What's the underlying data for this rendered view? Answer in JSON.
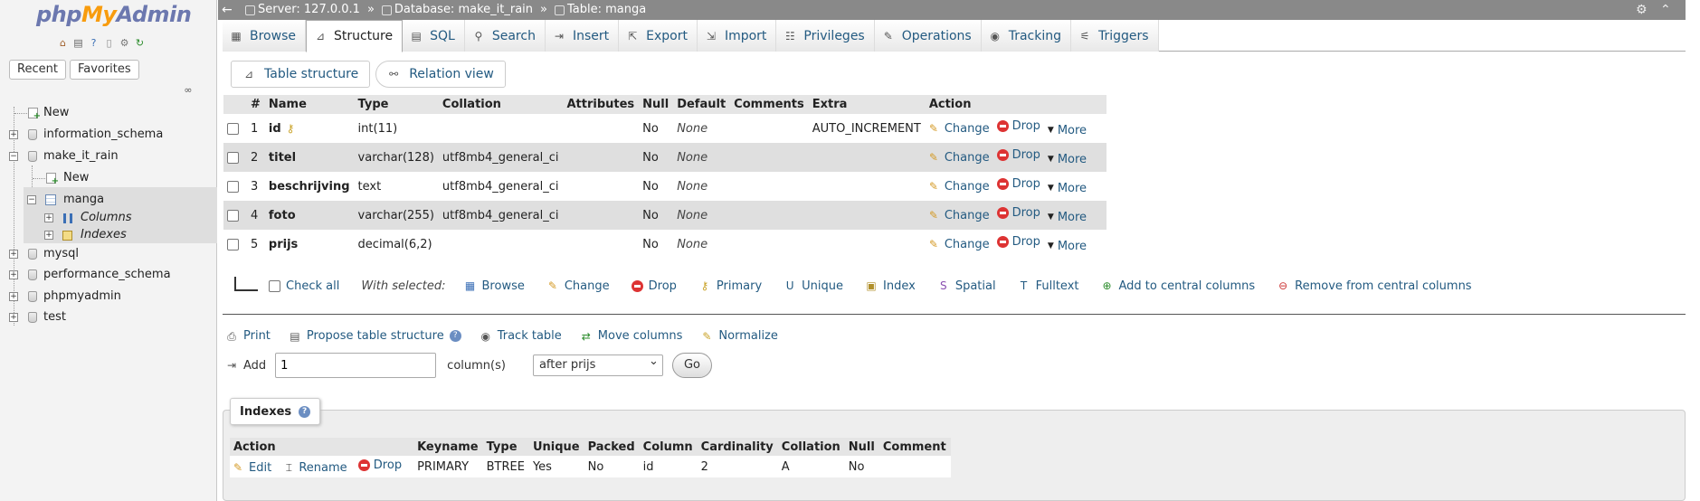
{
  "nav": {
    "logo": {
      "php": "php",
      "my": "My",
      "admin": "Admin"
    },
    "quick_icons": [
      "home-icon",
      "exit-icon",
      "help-icon",
      "docs-icon",
      "settings-icon",
      "reload-icon"
    ],
    "tabs": [
      "Recent",
      "Favorites"
    ],
    "tree": {
      "new": "New",
      "databases": [
        "information_schema",
        "make_it_rain",
        "mysql",
        "performance_schema",
        "phpmyadmin",
        "test"
      ],
      "make_it_rain_children": {
        "new": "New",
        "table": "manga",
        "columns": "Columns",
        "indexes": "Indexes"
      }
    }
  },
  "breadcrumb": {
    "server": "Server: 127.0.0.1",
    "database": "Database: make_it_rain",
    "table": "Table: manga",
    "separator": "»"
  },
  "tabs": [
    {
      "label": "Browse",
      "icon": "browse-icon"
    },
    {
      "label": "Structure",
      "icon": "structure-icon",
      "active": true
    },
    {
      "label": "SQL",
      "icon": "sql-icon"
    },
    {
      "label": "Search",
      "icon": "search-icon"
    },
    {
      "label": "Insert",
      "icon": "insert-icon"
    },
    {
      "label": "Export",
      "icon": "export-icon"
    },
    {
      "label": "Import",
      "icon": "import-icon"
    },
    {
      "label": "Privileges",
      "icon": "privileges-icon"
    },
    {
      "label": "Operations",
      "icon": "operations-icon"
    },
    {
      "label": "Tracking",
      "icon": "tracking-icon"
    },
    {
      "label": "Triggers",
      "icon": "triggers-icon"
    }
  ],
  "subtabs": {
    "table_structure": "Table structure",
    "relation_view": "Relation view"
  },
  "structure": {
    "headers": [
      "#",
      "Name",
      "Type",
      "Collation",
      "Attributes",
      "Null",
      "Default",
      "Comments",
      "Extra",
      "Action"
    ],
    "rows": [
      {
        "num": "1",
        "name": "id",
        "type": "int(11)",
        "collation": "",
        "attributes": "",
        "null": "No",
        "default": "None",
        "comments": "",
        "extra": "AUTO_INCREMENT"
      },
      {
        "num": "2",
        "name": "titel",
        "type": "varchar(128)",
        "collation": "utf8mb4_general_ci",
        "attributes": "",
        "null": "No",
        "default": "None",
        "comments": "",
        "extra": ""
      },
      {
        "num": "3",
        "name": "beschrijving",
        "type": "text",
        "collation": "utf8mb4_general_ci",
        "attributes": "",
        "null": "No",
        "default": "None",
        "comments": "",
        "extra": ""
      },
      {
        "num": "4",
        "name": "foto",
        "type": "varchar(255)",
        "collation": "utf8mb4_general_ci",
        "attributes": "",
        "null": "No",
        "default": "None",
        "comments": "",
        "extra": ""
      },
      {
        "num": "5",
        "name": "prijs",
        "type": "decimal(6,2)",
        "collation": "",
        "attributes": "",
        "null": "No",
        "default": "None",
        "comments": "",
        "extra": ""
      }
    ],
    "actions": {
      "change": "Change",
      "drop": "Drop",
      "more": "More"
    }
  },
  "bulk": {
    "check_all": "Check all",
    "with_selected": "With selected:",
    "items": [
      "Browse",
      "Change",
      "Drop",
      "Primary",
      "Unique",
      "Index",
      "Spatial",
      "Fulltext",
      "Add to central columns",
      "Remove from central columns"
    ]
  },
  "tools": {
    "print": "Print",
    "propose": "Propose table structure",
    "track": "Track table",
    "move": "Move columns",
    "normalize": "Normalize"
  },
  "add_columns": {
    "label": "Add",
    "value": "1",
    "suffix": "column(s)",
    "position": "after prijs",
    "go": "Go"
  },
  "indexes": {
    "legend": "Indexes",
    "headers": [
      "Action",
      "Keyname",
      "Type",
      "Unique",
      "Packed",
      "Column",
      "Cardinality",
      "Collation",
      "Null",
      "Comment"
    ],
    "actions": {
      "edit": "Edit",
      "rename": "Rename",
      "drop": "Drop"
    },
    "row": {
      "keyname": "PRIMARY",
      "type": "BTREE",
      "unique": "Yes",
      "packed": "No",
      "column": "id",
      "cardinality": "2",
      "collation": "A",
      "null": "No",
      "comment": ""
    }
  }
}
